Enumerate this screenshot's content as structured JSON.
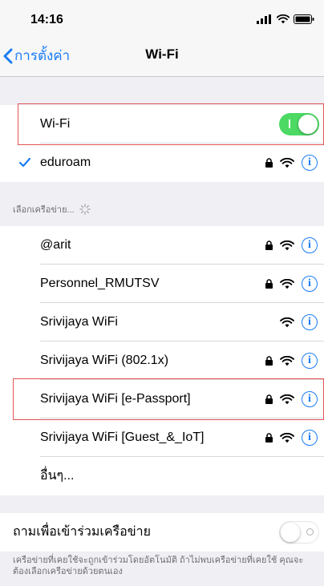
{
  "status_bar": {
    "time": "14:16"
  },
  "nav": {
    "back_label": "การตั้งค่า",
    "title": "Wi-Fi"
  },
  "wifi_toggle": {
    "label": "Wi-Fi",
    "state": "on"
  },
  "connected_network": {
    "name": "eduroam",
    "secured": true
  },
  "networks_section": {
    "header": "เลือกเครือข่าย..."
  },
  "networks": [
    {
      "name": "@arit",
      "secured": true
    },
    {
      "name": "Personnel_RMUTSV",
      "secured": true
    },
    {
      "name": "Srivijaya WiFi",
      "secured": false
    },
    {
      "name": "Srivijaya WiFi (802.1x)",
      "secured": true
    },
    {
      "name": "Srivijaya WiFi [e-Passport]",
      "secured": true
    },
    {
      "name": "Srivijaya WiFi [Guest_&_IoT]",
      "secured": true
    }
  ],
  "other_label": "อื่นๆ...",
  "ask_to_join": {
    "label": "ถามเพื่อเข้าร่วมเครือข่าย",
    "state": "off"
  },
  "ask_to_join_footer": "เครือข่ายที่เคยใช้จะถูกเข้าร่วมโดยอัตโนมัติ ถ้าไม่พบเครือข่ายที่เคยใช้ คุณจะต้องเลือกเครือข่ายด้วยตนเอง",
  "info_glyph": "i",
  "colors": {
    "accent": "#1a7cf5",
    "toggle_on": "#4cd964",
    "highlight": "#e15454"
  }
}
